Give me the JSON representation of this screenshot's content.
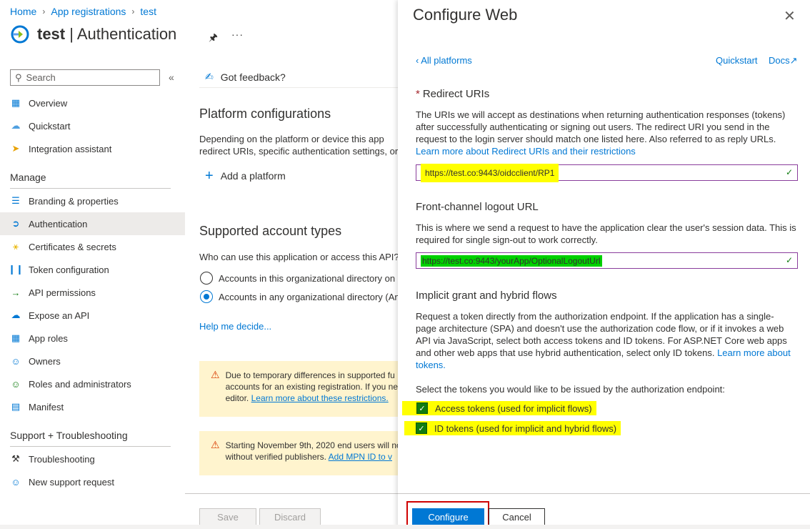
{
  "breadcrumb": {
    "home": "Home",
    "app_registrations": "App registrations",
    "test": "test"
  },
  "title": {
    "app": "test",
    "page": "| Authentication"
  },
  "sidebar": {
    "search_placeholder": "Search",
    "top_items": [
      {
        "label": "Overview",
        "icon": "grid-icon"
      },
      {
        "label": "Quickstart",
        "icon": "cloud-icon"
      },
      {
        "label": "Integration assistant",
        "icon": "rocket-icon"
      }
    ],
    "manage_heading": "Manage",
    "manage_items": [
      {
        "label": "Branding & properties",
        "icon": "branding-icon"
      },
      {
        "label": "Authentication",
        "icon": "auth-icon"
      },
      {
        "label": "Certificates & secrets",
        "icon": "key-icon"
      },
      {
        "label": "Token configuration",
        "icon": "token-icon"
      },
      {
        "label": "API permissions",
        "icon": "permissions-icon"
      },
      {
        "label": "Expose an API",
        "icon": "cloud-api-icon"
      },
      {
        "label": "App roles",
        "icon": "roles-icon"
      },
      {
        "label": "Owners",
        "icon": "owners-icon"
      },
      {
        "label": "Roles and administrators",
        "icon": "admin-icon"
      },
      {
        "label": "Manifest",
        "icon": "manifest-icon"
      }
    ],
    "support_heading": "Support + Troubleshooting",
    "support_items": [
      {
        "label": "Troubleshooting",
        "icon": "wrench-icon"
      },
      {
        "label": "New support request",
        "icon": "support-icon"
      }
    ]
  },
  "main": {
    "feedback": "Got feedback?",
    "platform_title": "Platform configurations",
    "platform_desc_1": "Depending on the platform or device this app",
    "platform_desc_2": "redirect URIs, specific authentication settings, or",
    "add_platform": "Add a platform",
    "account_title": "Supported account types",
    "account_question": "Who can use this application or access this API?",
    "radio_1": "Accounts in this organizational directory on",
    "radio_2": "Accounts in any organizational directory (An",
    "help_link": "Help me decide...",
    "warn_1_line1": "Due to temporary differences in supported fu",
    "warn_1_line2": "accounts for an existing registration. If you ne",
    "warn_1_line3_text": "editor.",
    "warn_1_link": "Learn more about these restrictions.",
    "warn_2_line1": "Starting November 9th, 2020 end users will no",
    "warn_2_line2_text": "without verified publishers.",
    "warn_2_link": "Add MPN ID to v",
    "save": "Save",
    "discard": "Discard"
  },
  "panel": {
    "title": "Configure Web",
    "back": "All platforms",
    "quickstart": "Quickstart",
    "docs": "Docs",
    "redirect_heading": "Redirect URIs",
    "redirect_desc_1": "The URIs we will accept as destinations when returning authentication responses (tokens)",
    "redirect_desc_2": "after successfully authenticating or signing out users. The redirect URI you send in the",
    "redirect_desc_3": "request to the login server should match one listed here. Also referred to as reply URLs.",
    "redirect_link": "Learn more about Redirect URIs and their restrictions",
    "redirect_value": "https://test.co:9443/oidcclient/RP1",
    "logout_heading": "Front-channel logout URL",
    "logout_desc_1": "This is where we send a request to have the application clear the user's session data. This is",
    "logout_desc_2": "required for single sign-out to work correctly.",
    "logout_value": "https://test.co:9443/yourApp/OptionalLogoutUrl",
    "implicit_heading": "Implicit grant and hybrid flows",
    "implicit_desc_1": "Request a token directly from the authorization endpoint. If the application has a single-",
    "implicit_desc_2": "page architecture (SPA) and doesn't use the authorization code flow, or if it invokes a web",
    "implicit_desc_3": "API via JavaScript, select both access tokens and ID tokens. For ASP.NET Core web apps",
    "implicit_desc_4_text": "and other web apps that use hybrid authentication, select only ID tokens.",
    "implicit_link_a": "Learn more about",
    "implicit_link_b": "tokens.",
    "select_tokens": "Select the tokens you would like to be issued by the authorization endpoint:",
    "access_tokens": "Access tokens (used for implicit flows)",
    "id_tokens": "ID tokens (used for implicit and hybrid flows)",
    "configure": "Configure",
    "cancel": "Cancel"
  },
  "colors": {
    "accent": "#0078d4",
    "highlight_yellow": "#ffff00",
    "highlight_green": "#00d000",
    "callout_red": "#d00000"
  }
}
